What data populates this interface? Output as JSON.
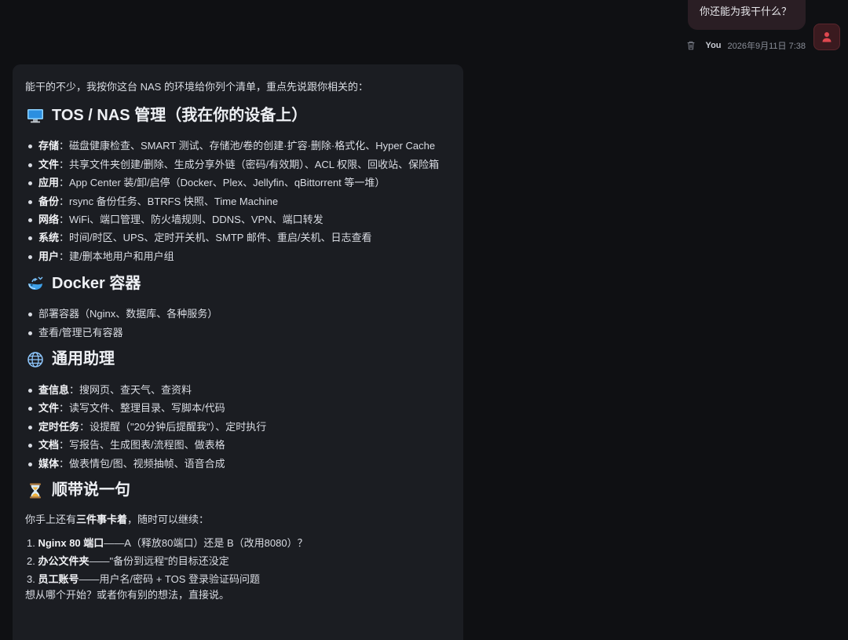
{
  "user": {
    "message": "你还能为我干什么？",
    "name": "You",
    "timestamp": "2026年9月11日 7:38"
  },
  "reply": {
    "intro": "能干的不少，我按你这台 NAS 的环境给你列个清单，重点先说跟你相关的：",
    "sections": [
      {
        "title": "TOS / NAS 管理（我在你的设备上）",
        "icon": "computer-icon",
        "items": [
          {
            "label": "存储",
            "text": "：磁盘健康检查、SMART 测试、存储池/卷的创建·扩容·删除·格式化、Hyper Cache"
          },
          {
            "label": "文件",
            "text": "：共享文件夹创建/删除、生成分享外链（密码/有效期）、ACL 权限、回收站、保险箱"
          },
          {
            "label": "应用",
            "text": "：App Center 装/卸/启停（Docker、Plex、Jellyfin、qBittorrent 等一堆）"
          },
          {
            "label": "备份",
            "text": "：rsync 备份任务、BTRFS 快照、Time Machine"
          },
          {
            "label": "网络",
            "text": "：WiFi、端口管理、防火墙规则、DDNS、VPN、端口转发"
          },
          {
            "label": "系统",
            "text": "：时间/时区、UPS、定时开关机、SMTP 邮件、重启/关机、日志查看"
          },
          {
            "label": "用户",
            "text": "：建/删本地用户和用户组"
          }
        ]
      },
      {
        "title": "Docker 容器",
        "icon": "whale-icon",
        "items": [
          {
            "label": "",
            "text": "部署容器（Nginx、数据库、各种服务）"
          },
          {
            "label": "",
            "text": "查看/管理已有容器"
          }
        ]
      },
      {
        "title": "通用助理",
        "icon": "globe-icon",
        "items": [
          {
            "label": "查信息",
            "text": "：搜网页、查天气、查资料"
          },
          {
            "label": "文件",
            "text": "：读写文件、整理目录、写脚本/代码"
          },
          {
            "label": "定时任务",
            "text": "：设提醒（\"20分钟后提醒我\"）、定时执行"
          },
          {
            "label": "文档",
            "text": "：写报告、生成图表/流程图、做表格"
          },
          {
            "label": "媒体",
            "text": "：做表情包/图、视频抽帧、语音合成"
          }
        ]
      }
    ],
    "aside": {
      "title": "顺带说一句",
      "icon": "hourglass-icon",
      "lead_pre": "你手上还有",
      "lead_bold": "三件事卡着",
      "lead_post": "，随时可以继续：",
      "items": [
        {
          "num": "1.",
          "label": "Nginx 80 端口",
          "text": "——A（释放80端口）还是 B（改用8080）？"
        },
        {
          "num": "2.",
          "label": "办公文件夹",
          "text": "——\"备份到远程\"的目标还没定"
        },
        {
          "num": "3.",
          "label": "员工账号",
          "text": "——用户名/密码 + TOS 登录验证码问题"
        }
      ],
      "closing": "想从哪个开始？或者你有别的想法，直接说。"
    }
  },
  "colors": {
    "background": "#0f1013",
    "card": "#1b1d22",
    "user_bubble": "#2a1e24",
    "avatar_accent": "#e0474f"
  }
}
